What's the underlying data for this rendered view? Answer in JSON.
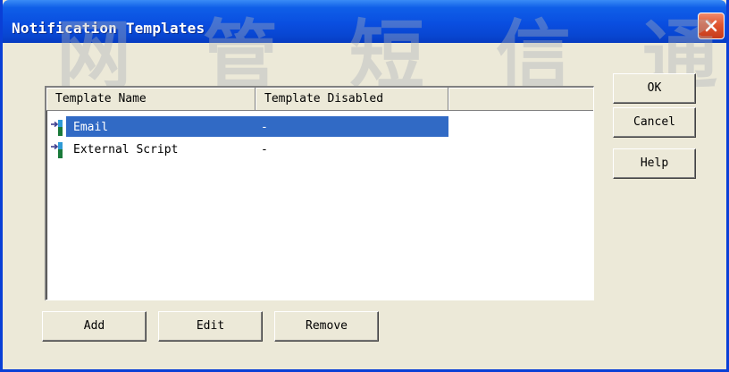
{
  "window": {
    "title": "Notification Templates",
    "close_icon": "close-icon"
  },
  "watermark": [
    "网",
    "管",
    "短",
    "信",
    "通"
  ],
  "list": {
    "columns": [
      "Template Name",
      "Template Disabled"
    ],
    "rows": [
      {
        "name": "Email",
        "disabled": "-",
        "selected": true,
        "icon": "template-icon"
      },
      {
        "name": "External Script",
        "disabled": "-",
        "selected": false,
        "icon": "template-icon"
      }
    ]
  },
  "buttons": {
    "add": "Add",
    "edit": "Edit",
    "remove": "Remove",
    "ok": "OK",
    "cancel": "Cancel",
    "help": "Help"
  },
  "colors": {
    "titlebar": "#0a4ee0",
    "selection": "#316ac5",
    "close": "#e0552f"
  }
}
